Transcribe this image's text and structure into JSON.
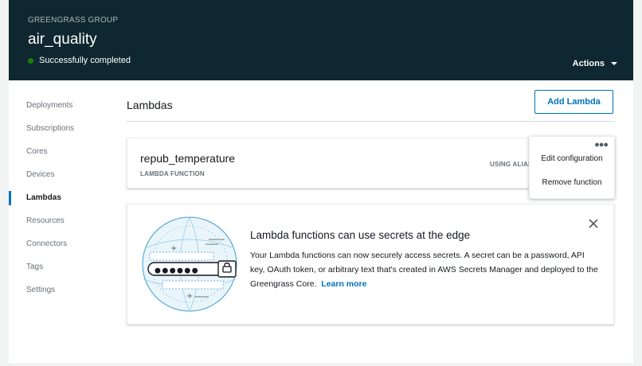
{
  "header": {
    "group_label": "GREENGRASS GROUP",
    "group_name": "air_quality",
    "status": "Successfully completed",
    "actions_label": "Actions"
  },
  "sidebar": {
    "items": [
      {
        "label": "Deployments",
        "active": false
      },
      {
        "label": "Subscriptions",
        "active": false
      },
      {
        "label": "Cores",
        "active": false
      },
      {
        "label": "Devices",
        "active": false
      },
      {
        "label": "Lambdas",
        "active": true
      },
      {
        "label": "Resources",
        "active": false
      },
      {
        "label": "Connectors",
        "active": false
      },
      {
        "label": "Tags",
        "active": false
      },
      {
        "label": "Settings",
        "active": false
      }
    ]
  },
  "main": {
    "title": "Lambdas",
    "add_button": "Add Lambda",
    "lambda": {
      "name": "repub_temperature",
      "type": "LAMBDA FUNCTION",
      "alias": "USING ALIAS"
    },
    "menu": {
      "more_icon": "ellipsis-icon",
      "items": [
        "Edit configuration",
        "Remove function"
      ]
    },
    "info": {
      "title": "Lambda functions can use secrets at the edge",
      "body": "Your Lambda functions can now securely access secrets. A secret can be a password, API key, OAuth token, or arbitrary text that's created in AWS Secrets Manager and deployed to the Greengrass Core.",
      "learn_more": "Learn more",
      "password_dots": "●●●●●●"
    }
  },
  "colors": {
    "header_bg": "#0e2730",
    "accent": "#0073bb",
    "success": "#1d8102",
    "illustration": "#3f9fd3"
  }
}
